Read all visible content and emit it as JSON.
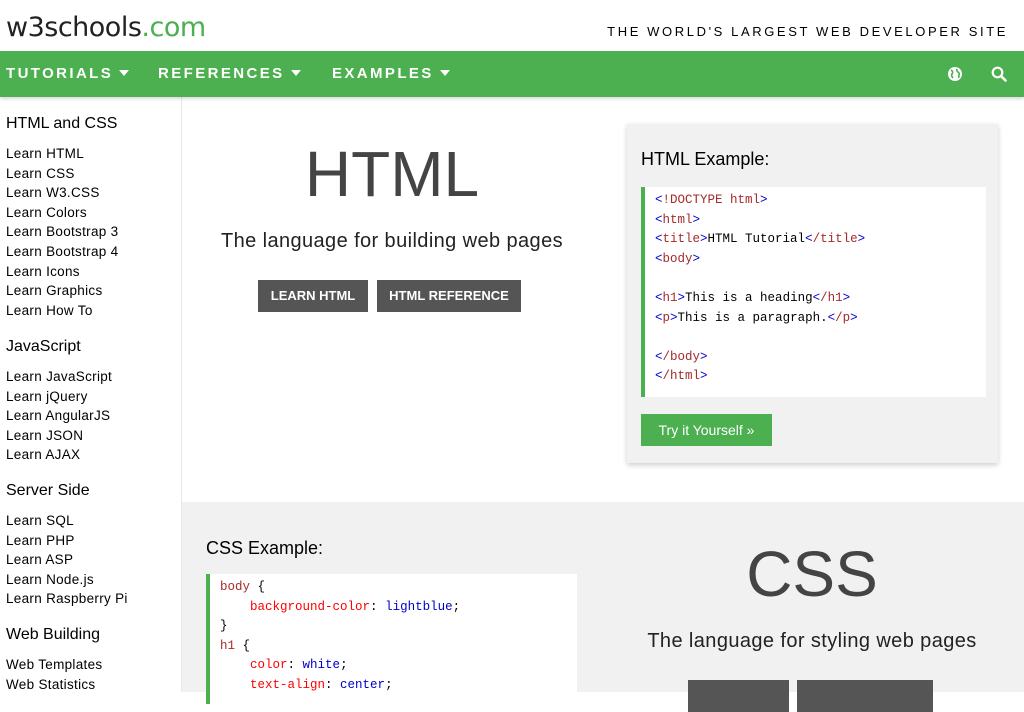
{
  "header": {
    "logo_w3": "w3schools",
    "logo_com": ".com",
    "tagline": "THE WORLD'S LARGEST WEB DEVELOPER SITE"
  },
  "nav": {
    "items": [
      {
        "label": "TUTORIALS"
      },
      {
        "label": "REFERENCES"
      },
      {
        "label": "EXAMPLES"
      }
    ],
    "icons": [
      "globe-icon",
      "search-icon"
    ]
  },
  "sidebar": {
    "sections": [
      {
        "heading": "HTML and CSS",
        "links": [
          "Learn HTML",
          "Learn CSS",
          "Learn W3.CSS",
          "Learn Colors",
          "Learn Bootstrap 3",
          "Learn Bootstrap 4",
          "Learn Icons",
          "Learn Graphics",
          "Learn How To"
        ]
      },
      {
        "heading": "JavaScript",
        "links": [
          "Learn JavaScript",
          "Learn jQuery",
          "Learn AngularJS",
          "Learn JSON",
          "Learn AJAX"
        ]
      },
      {
        "heading": "Server Side",
        "links": [
          "Learn SQL",
          "Learn PHP",
          "Learn ASP",
          "Learn Node.js",
          "Learn Raspberry Pi"
        ]
      },
      {
        "heading": "Web Building",
        "links": [
          "Web Templates",
          "Web Statistics"
        ]
      }
    ]
  },
  "html_section": {
    "title": "HTML",
    "subtitle": "The language for building web pages",
    "btn_learn": "LEARN HTML",
    "btn_reference": "HTML REFERENCE",
    "example_title": "HTML Example:",
    "try_button": "Try it Yourself »",
    "code": {
      "doctype_open": "<",
      "doctype": "!DOCTYPE html",
      "doctype_close": ">",
      "html_tag": "html",
      "title_tag": "title",
      "title_text": "HTML Tutorial",
      "title_close": "/title",
      "body_tag": "body",
      "h1_tag": "h1",
      "h1_text": "This is a heading",
      "h1_close": "/h1",
      "p_tag": "p",
      "p_text": "This is a paragraph.",
      "p_close": "/p",
      "body_close": "/body",
      "html_close": "/html"
    }
  },
  "css_section": {
    "title": "CSS",
    "subtitle": "The language for styling web pages",
    "example_title": "CSS Example:",
    "code": {
      "sel_body": "body",
      "open_brace": "{",
      "close_brace": "}",
      "prop_bg": "background-color",
      "val_bg": "lightblue",
      "sel_h1": "h1",
      "prop_color": "color",
      "val_color": "white",
      "prop_align": "text-align",
      "val_align": "center"
    }
  },
  "colors": {
    "brand_green": "#4CAF50",
    "button_dark": "#555555",
    "section_gray": "#f1f1f1"
  }
}
